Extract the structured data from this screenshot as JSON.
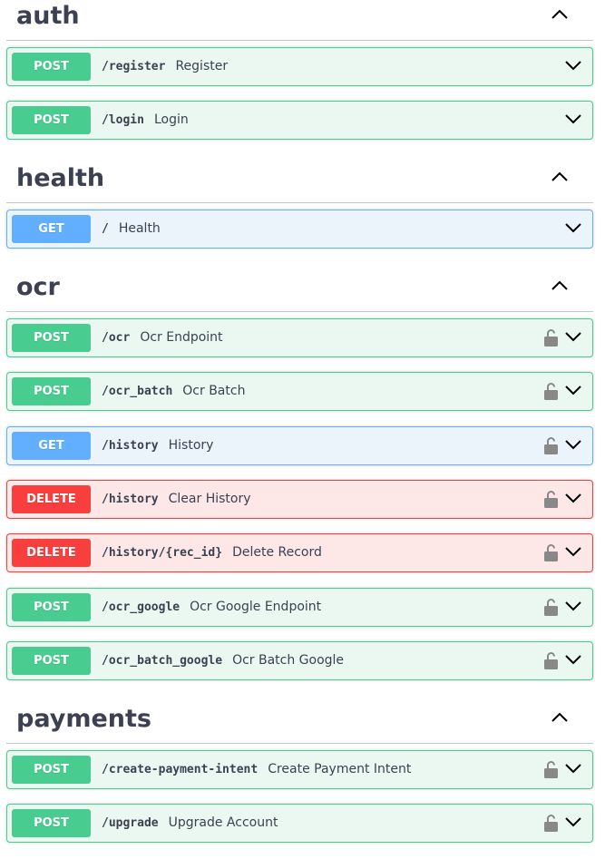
{
  "colors": {
    "post": "#49cc90",
    "get": "#61affe",
    "delete": "#f93e3e",
    "text": "#3b4151"
  },
  "icons": {
    "collapse": "chevron-up-icon",
    "expand": "chevron-down-icon",
    "lock": "lock-icon"
  },
  "sections": [
    {
      "title": "auth",
      "operations": [
        {
          "method": "POST",
          "path": "/register",
          "summary": "Register",
          "locked": false
        },
        {
          "method": "POST",
          "path": "/login",
          "summary": "Login",
          "locked": false
        }
      ]
    },
    {
      "title": "health",
      "operations": [
        {
          "method": "GET",
          "path": "/",
          "summary": "Health",
          "locked": false
        }
      ]
    },
    {
      "title": "ocr",
      "operations": [
        {
          "method": "POST",
          "path": "/ocr",
          "summary": "Ocr Endpoint",
          "locked": true
        },
        {
          "method": "POST",
          "path": "/ocr_batch",
          "summary": "Ocr Batch",
          "locked": true
        },
        {
          "method": "GET",
          "path": "/history",
          "summary": "History",
          "locked": true
        },
        {
          "method": "DELETE",
          "path": "/history",
          "summary": "Clear History",
          "locked": true
        },
        {
          "method": "DELETE",
          "path": "/history/{rec_id}",
          "summary": "Delete Record",
          "locked": true
        },
        {
          "method": "POST",
          "path": "/ocr_google",
          "summary": "Ocr Google Endpoint",
          "locked": true
        },
        {
          "method": "POST",
          "path": "/ocr_batch_google",
          "summary": "Ocr Batch Google",
          "locked": true
        }
      ]
    },
    {
      "title": "payments",
      "operations": [
        {
          "method": "POST",
          "path": "/create-payment-intent",
          "summary": "Create Payment Intent",
          "locked": true
        },
        {
          "method": "POST",
          "path": "/upgrade",
          "summary": "Upgrade Account",
          "locked": true
        }
      ]
    }
  ]
}
